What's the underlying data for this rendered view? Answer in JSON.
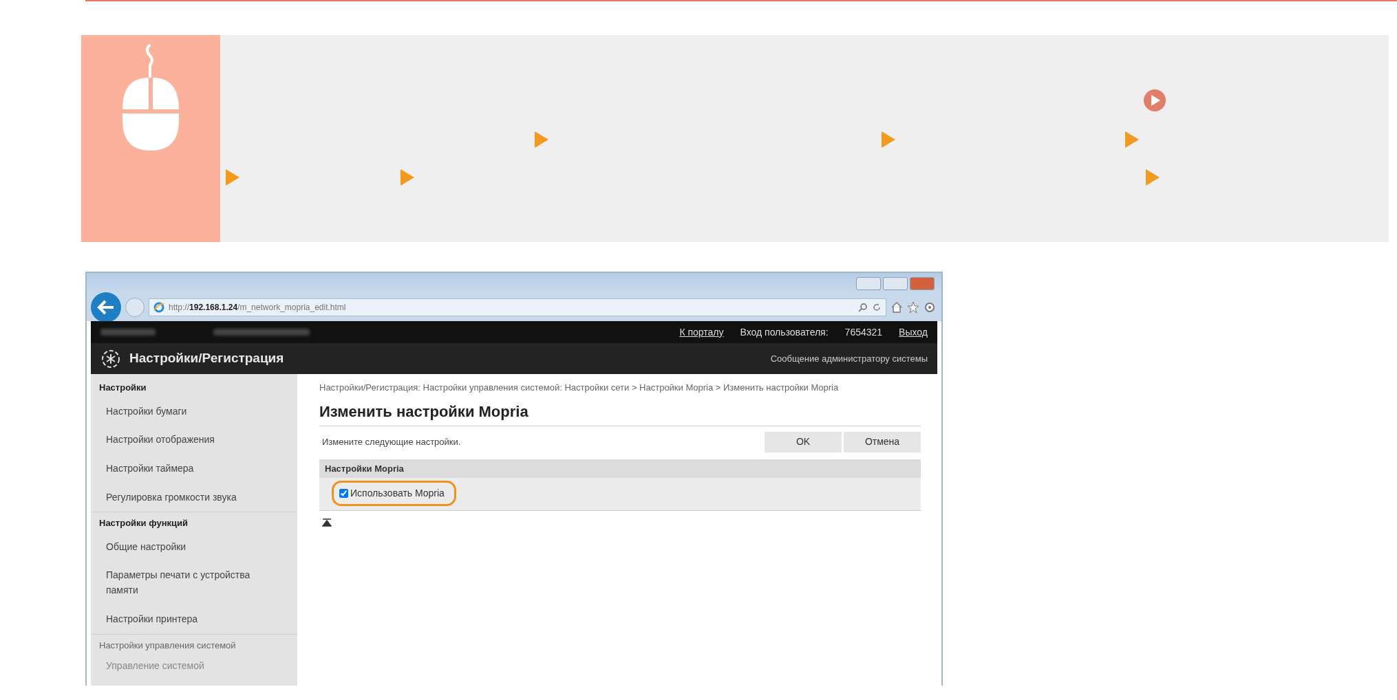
{
  "browser": {
    "url": "http://**192.168.1.24**/m_network_mopria_edit.html"
  },
  "top_bar": {
    "portal_link": "К порталу",
    "login_label": "Вход пользователя:",
    "user_id": "7654321",
    "logout": "Выход"
  },
  "header": {
    "title": "Настройки/Регистрация",
    "admin_link": "Сообщение администратору системы"
  },
  "sidebar": {
    "sections": [
      {
        "title": "Настройки",
        "items": [
          "Настройки бумаги",
          "Настройки отображения",
          "Настройки таймера",
          "Регулировка громкости звука"
        ]
      },
      {
        "title": "Настройки функций",
        "items": [
          "Общие настройки",
          "Параметры печати с устройства памяти",
          "Настройки принтера"
        ]
      },
      {
        "title": "Настройки управления системой",
        "items": [
          "Управление системой"
        ]
      }
    ]
  },
  "content": {
    "breadcrumb": "Настройки/Регистрация: Настройки управления системой: Настройки сети > Настройки Mopria > Изменить настройки Mopria",
    "title": "Изменить настройки Mopria",
    "instruction": "Измените следующие настройки.",
    "buttons": [
      "OK",
      "Отмена"
    ],
    "section_title": "Настройки Mopria",
    "checkbox": {
      "label": "Использовать Mopria",
      "checked": true,
      "highlighted": true
    }
  }
}
